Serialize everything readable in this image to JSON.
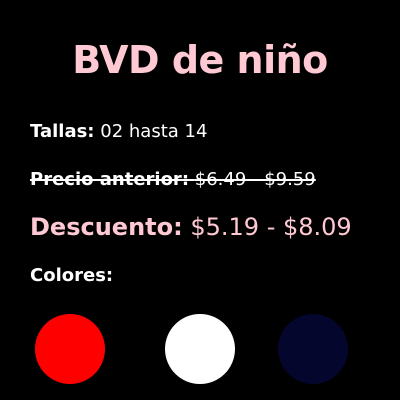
{
  "product": {
    "title": "BVD de niño"
  },
  "sizes": {
    "label": "Tallas:",
    "value": "02 hasta 14"
  },
  "old_price": {
    "label": "Precio anterior:",
    "value": "$6.49 - $9.59"
  },
  "discount": {
    "label": "Descuento:",
    "value": "$5.19 - $8.09"
  },
  "colors": {
    "label": "Colores:",
    "swatches": [
      {
        "name": "red",
        "hex": "#ff0000"
      },
      {
        "name": "white",
        "hex": "#ffffff"
      },
      {
        "name": "navy",
        "hex": "#05062e"
      }
    ]
  },
  "theme": {
    "accent": "#ffc9d3",
    "background": "#000000",
    "text": "#ffffff"
  }
}
